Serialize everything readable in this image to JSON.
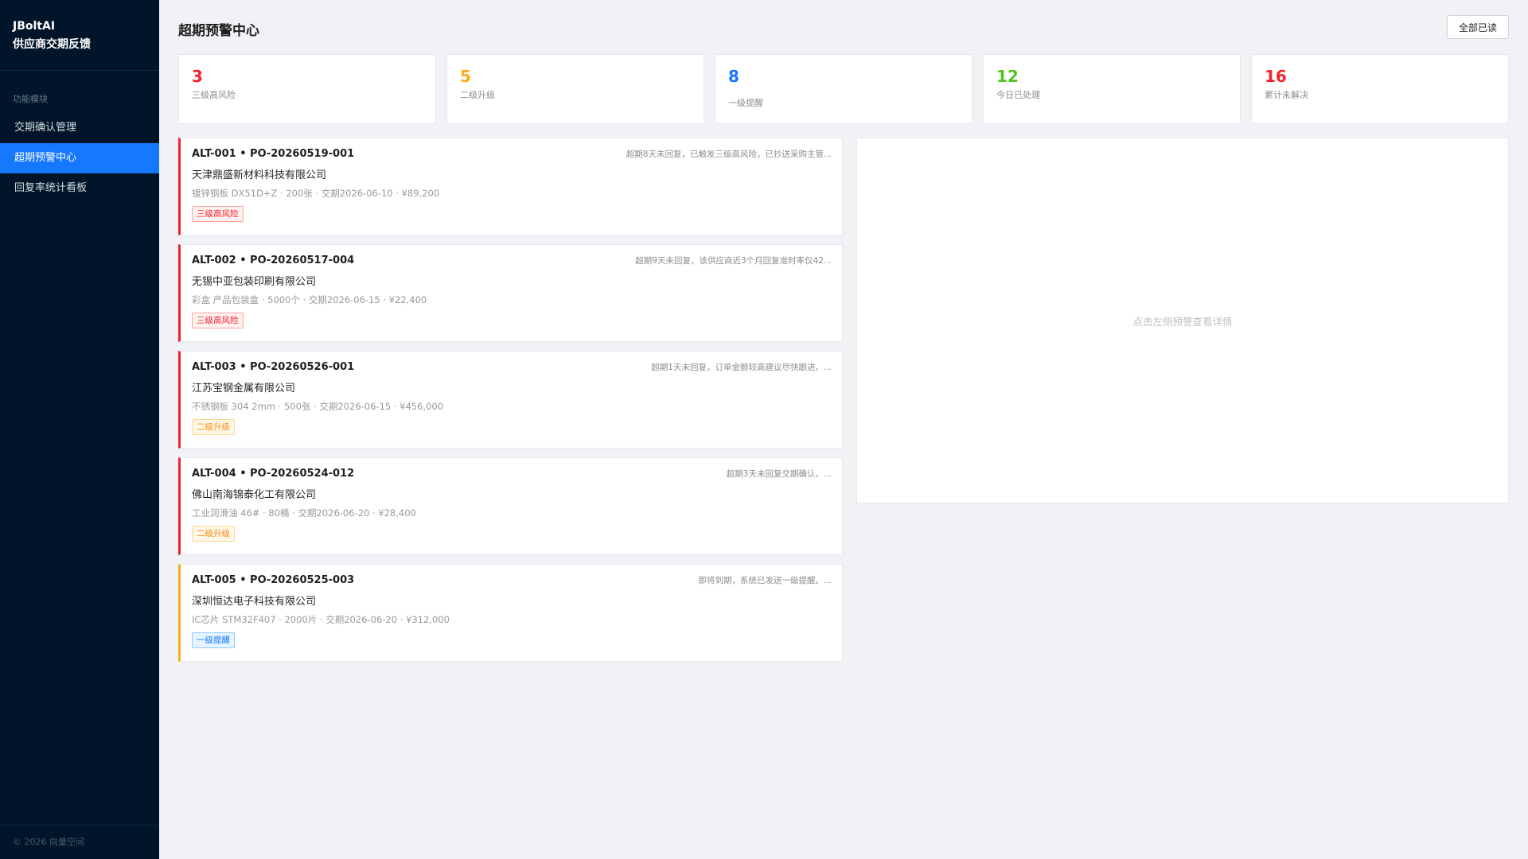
{
  "sidebar": {
    "brand_line1": "JBoltAI",
    "brand_line2": "供应商交期反馈",
    "section_title": "功能模块",
    "items": [
      {
        "label": "交期确认管理"
      },
      {
        "label": "超期预警中心"
      },
      {
        "label": "回复率统计看板"
      }
    ],
    "footer": "© 2026 向量空间"
  },
  "header": {
    "title": "超期预警中心",
    "mark_all_read": "全部已读"
  },
  "stats": [
    {
      "value": "3",
      "label": "三级高风险",
      "color": "#f5222d"
    },
    {
      "value": "5",
      "label": "二级升级",
      "color": "#faad14"
    },
    {
      "value": "8",
      "label": "一级提醒",
      "color": "#1677ff"
    },
    {
      "value": "12",
      "label": "今日已处理",
      "color": "#52c41a"
    },
    {
      "value": "16",
      "label": "累计未解决",
      "color": "#f5222d"
    }
  ],
  "alerts": [
    {
      "id": "ALT-001 • PO-20260519-001",
      "message": "超期8天未回复，已触发三级高风险，已抄送采购主管...",
      "company": "天津鼎盛新材料科技有限公司",
      "detail": "镀锌钢板 DX51D+Z · 200张 · 交期2026-06-10 · ¥89,200",
      "tag": "三级高风险",
      "tag_color": "red"
    },
    {
      "id": "ALT-002 • PO-20260517-004",
      "message": "超期9天未回复，该供应商近3个月回复准时率仅42...",
      "company": "无锡中亚包装印刷有限公司",
      "detail": "彩盒 产品包装盒 · 5000个 · 交期2026-06-15 · ¥22,400",
      "tag": "三级高风险",
      "tag_color": "red"
    },
    {
      "id": "ALT-003 • PO-20260526-001",
      "message": "超期1天未回复，订单金额较高建议尽快跟进。...",
      "company": "江苏宝钢金属有限公司",
      "detail": "不锈钢板 304 2mm · 500张 · 交期2026-06-15 · ¥456,000",
      "tag": "二级升级",
      "tag_color": "orange"
    },
    {
      "id": "ALT-004 • PO-20260524-012",
      "message": "超期3天未回复交期确认。...",
      "company": "佛山南海锦泰化工有限公司",
      "detail": "工业润滑油 46# · 80桶 · 交期2026-06-20 · ¥28,400",
      "tag": "二级升级",
      "tag_color": "orange"
    },
    {
      "id": "ALT-005 • PO-20260525-003",
      "message": "即将到期，系统已发送一级提醒。...",
      "company": "深圳恒达电子科技有限公司",
      "detail": "IC芯片 STM32F407 · 2000片 · 交期2026-06-20 · ¥312,000",
      "tag": "一级提醒",
      "tag_color": "blue"
    }
  ],
  "detail_panel": {
    "placeholder": "点击左侧预警查看详情"
  }
}
